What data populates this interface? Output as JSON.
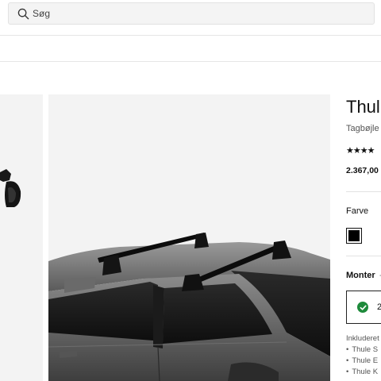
{
  "search": {
    "placeholder": "Søg"
  },
  "product": {
    "title": "Thul",
    "subtitle": "Tagbøjle",
    "rating_stars": "★★★★",
    "rating_value": 4,
    "price": "2.367,00",
    "color_label": "Farve",
    "selected_color": "#000000",
    "mount_label": "Monter",
    "mount_dash": "-",
    "mount_option": "2",
    "included_label": "Inkluderet",
    "included_items": [
      "Thule S",
      "Thule E",
      "Thule K"
    ]
  },
  "colors": {
    "check_green": "#1e8a3b",
    "gallery_bg": "#f3f3f3"
  }
}
